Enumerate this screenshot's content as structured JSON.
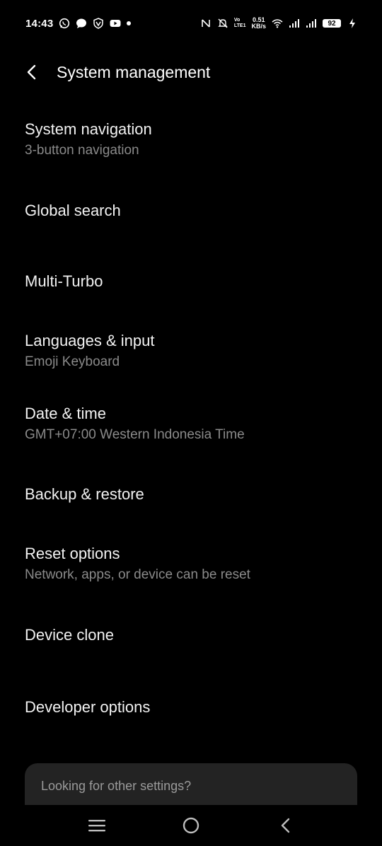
{
  "status_bar": {
    "time": "14:43",
    "volte_top": "Vo",
    "volte_bottom": "LTE1",
    "speed_value": "0.51",
    "speed_unit": "KB/s",
    "battery": "92"
  },
  "app_bar": {
    "title": "System management"
  },
  "settings": [
    {
      "title": "System navigation",
      "subtitle": "3-button navigation"
    },
    {
      "title": "Global search",
      "subtitle": ""
    },
    {
      "title": "Multi-Turbo",
      "subtitle": ""
    },
    {
      "title": "Languages & input",
      "subtitle": "Emoji Keyboard"
    },
    {
      "title": "Date & time",
      "subtitle": "GMT+07:00 Western Indonesia Time"
    },
    {
      "title": "Backup & restore",
      "subtitle": ""
    },
    {
      "title": "Reset options",
      "subtitle": "Network, apps, or device can be reset"
    },
    {
      "title": "Device clone",
      "subtitle": ""
    },
    {
      "title": "Developer options",
      "subtitle": ""
    }
  ],
  "card": {
    "text": "Looking for other settings?"
  },
  "icons": {
    "back": "chevron-left-icon",
    "nav_recents": "menu-icon",
    "nav_home": "circle-home-icon",
    "nav_back": "chevron-back-icon"
  }
}
